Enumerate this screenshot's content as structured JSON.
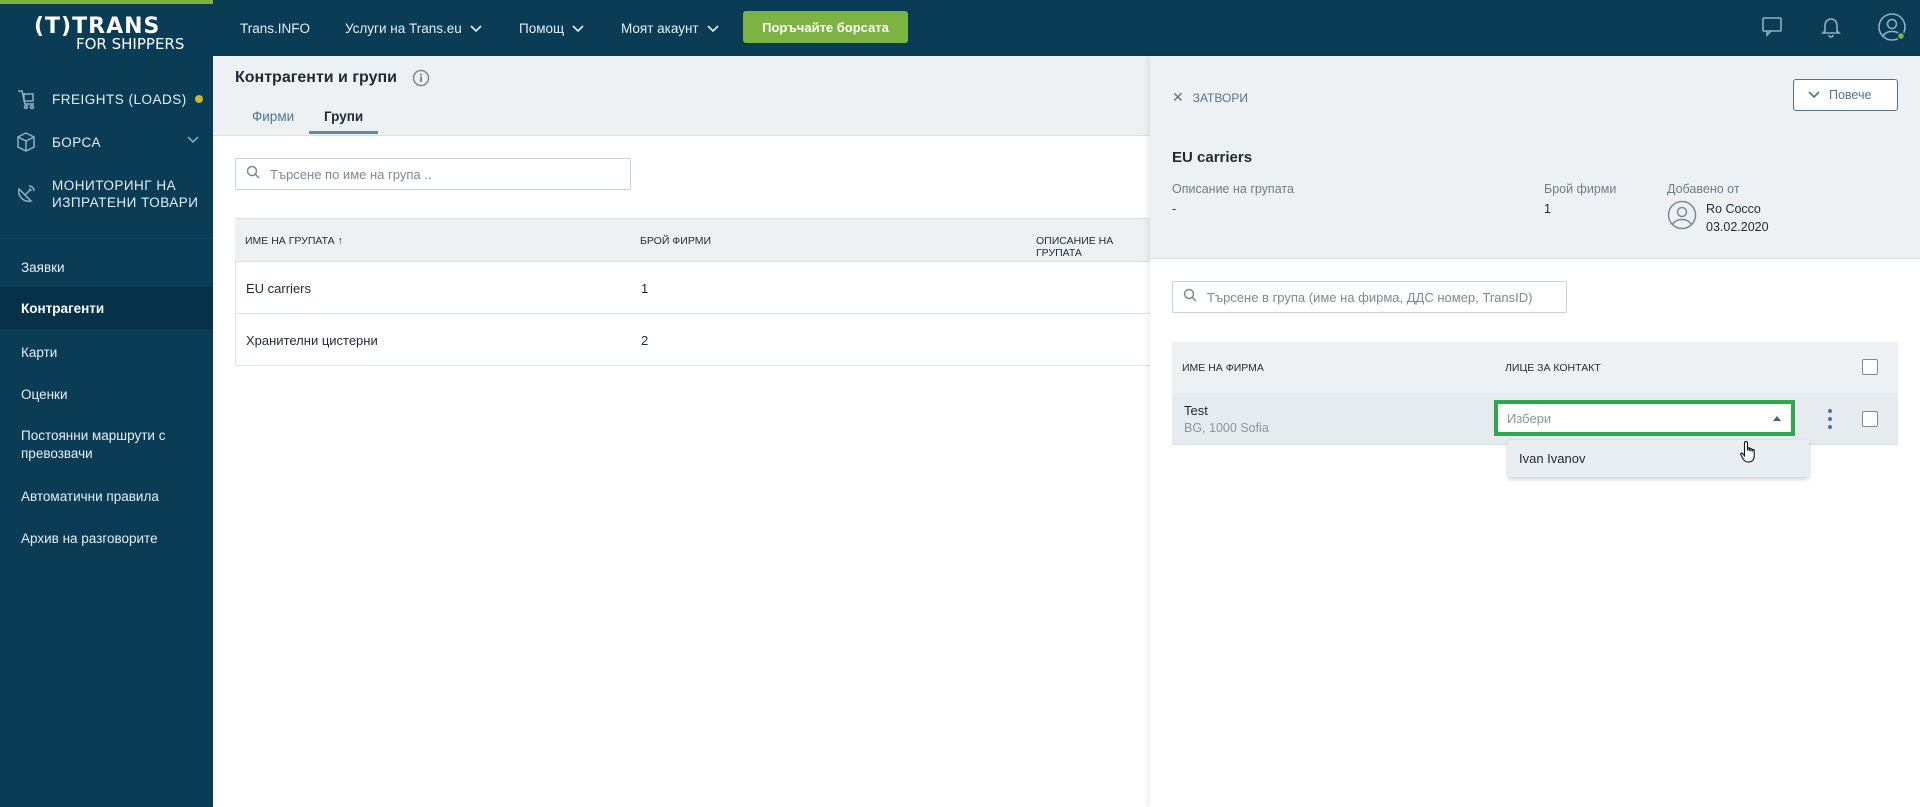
{
  "colors": {
    "sidebar_bg": "#0b3c56",
    "accent_green": "#7cb342",
    "focus_green": "#2ea84e",
    "link_blue": "#4e7590"
  },
  "brand": {
    "line1": "(T)TRANS",
    "line2": "FOR SHIPPERS"
  },
  "sidebar": {
    "modules": [
      {
        "label": "FREIGHTS (LOADS)",
        "icon": "freight-cart-icon",
        "has_dot": true
      },
      {
        "label": "БОРСА",
        "icon": "cube-icon",
        "has_chevron": true
      },
      {
        "label": "МОНИТОРИНГ НА ИЗПРАТЕНИ ТОВАРИ",
        "icon": "satellite-dish-icon"
      }
    ],
    "items": [
      {
        "label": "Заявки"
      },
      {
        "label": "Контрагенти",
        "active": true
      },
      {
        "label": "Карти"
      },
      {
        "label": "Оценки"
      },
      {
        "label": "Постоянни маршрути с превозвачи"
      },
      {
        "label": "Автоматични правила"
      },
      {
        "label": "Архив на разговорите"
      }
    ]
  },
  "topnav": {
    "items": [
      "Trans.INFO",
      "Услуги на Trans.eu",
      "Помощ",
      "Моят акаунт"
    ],
    "cta": "Поръчайте борсата",
    "icons": [
      "chat-icon",
      "bell-icon",
      "user-account-icon"
    ]
  },
  "main": {
    "title": "Контрагенти и групи",
    "tabs": [
      {
        "label": "Фирми"
      },
      {
        "label": "Групи",
        "active": true
      }
    ],
    "search_placeholder": "Търсене по име на група ..",
    "table": {
      "headers": [
        "ИМЕ НА ГРУПАТА ↑",
        "БРОЙ ФИРМИ",
        "ОПИСАНИЕ НА ГРУПАТА"
      ],
      "rows": [
        {
          "name": "EU carriers",
          "count": "1"
        },
        {
          "name": "Хранителни цистерни",
          "count": "2"
        }
      ]
    }
  },
  "panel": {
    "close_label": "ЗАТВОРИ",
    "more_label": "Повече",
    "group_name": "EU carriers",
    "desc_label": "Описание на групата",
    "desc_value": "-",
    "count_label": "Брой фирми",
    "count_value": "1",
    "added_label": "Добавено от",
    "added_by": "Ro Cocco",
    "added_date": "03.02.2020",
    "search_placeholder": "Търсене в група (име на фирма, ДДС номер, TransID)",
    "table": {
      "headers": [
        "ИМЕ НА ФИРМА",
        "ЛИЦЕ ЗА КОНТАКТ"
      ],
      "rows": [
        {
          "company": "Test",
          "location": "BG, 1000 Sofia",
          "contact_placeholder": "Избери"
        }
      ]
    },
    "dropdown_option": "Ivan Ivanov"
  }
}
